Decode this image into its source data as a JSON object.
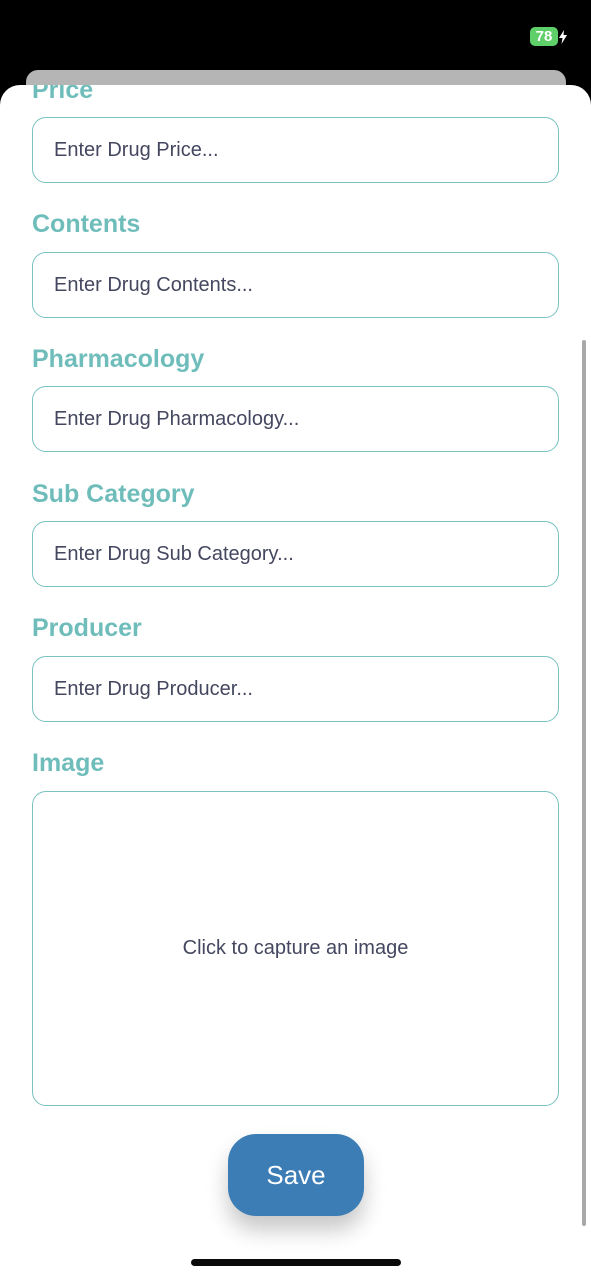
{
  "status_bar": {
    "battery_level": "78",
    "battery_color": "#5fcf6a",
    "charging_icon": "bolt-icon"
  },
  "form": {
    "fields": [
      {
        "label": "Price",
        "placeholder": "Enter Drug Price..."
      },
      {
        "label": "Contents",
        "placeholder": "Enter Drug Contents..."
      },
      {
        "label": "Pharmacology",
        "placeholder": "Enter Drug Pharmacology..."
      },
      {
        "label": "Sub Category",
        "placeholder": "Enter Drug Sub Category..."
      },
      {
        "label": "Producer",
        "placeholder": "Enter Drug Producer..."
      }
    ],
    "image": {
      "label": "Image",
      "hint": "Click to capture an image"
    },
    "save_label": "Save"
  },
  "colors": {
    "accent_label": "#6fbdbb",
    "input_border": "#78c2bf",
    "button": "#3b7db4",
    "text": "#44475f"
  }
}
